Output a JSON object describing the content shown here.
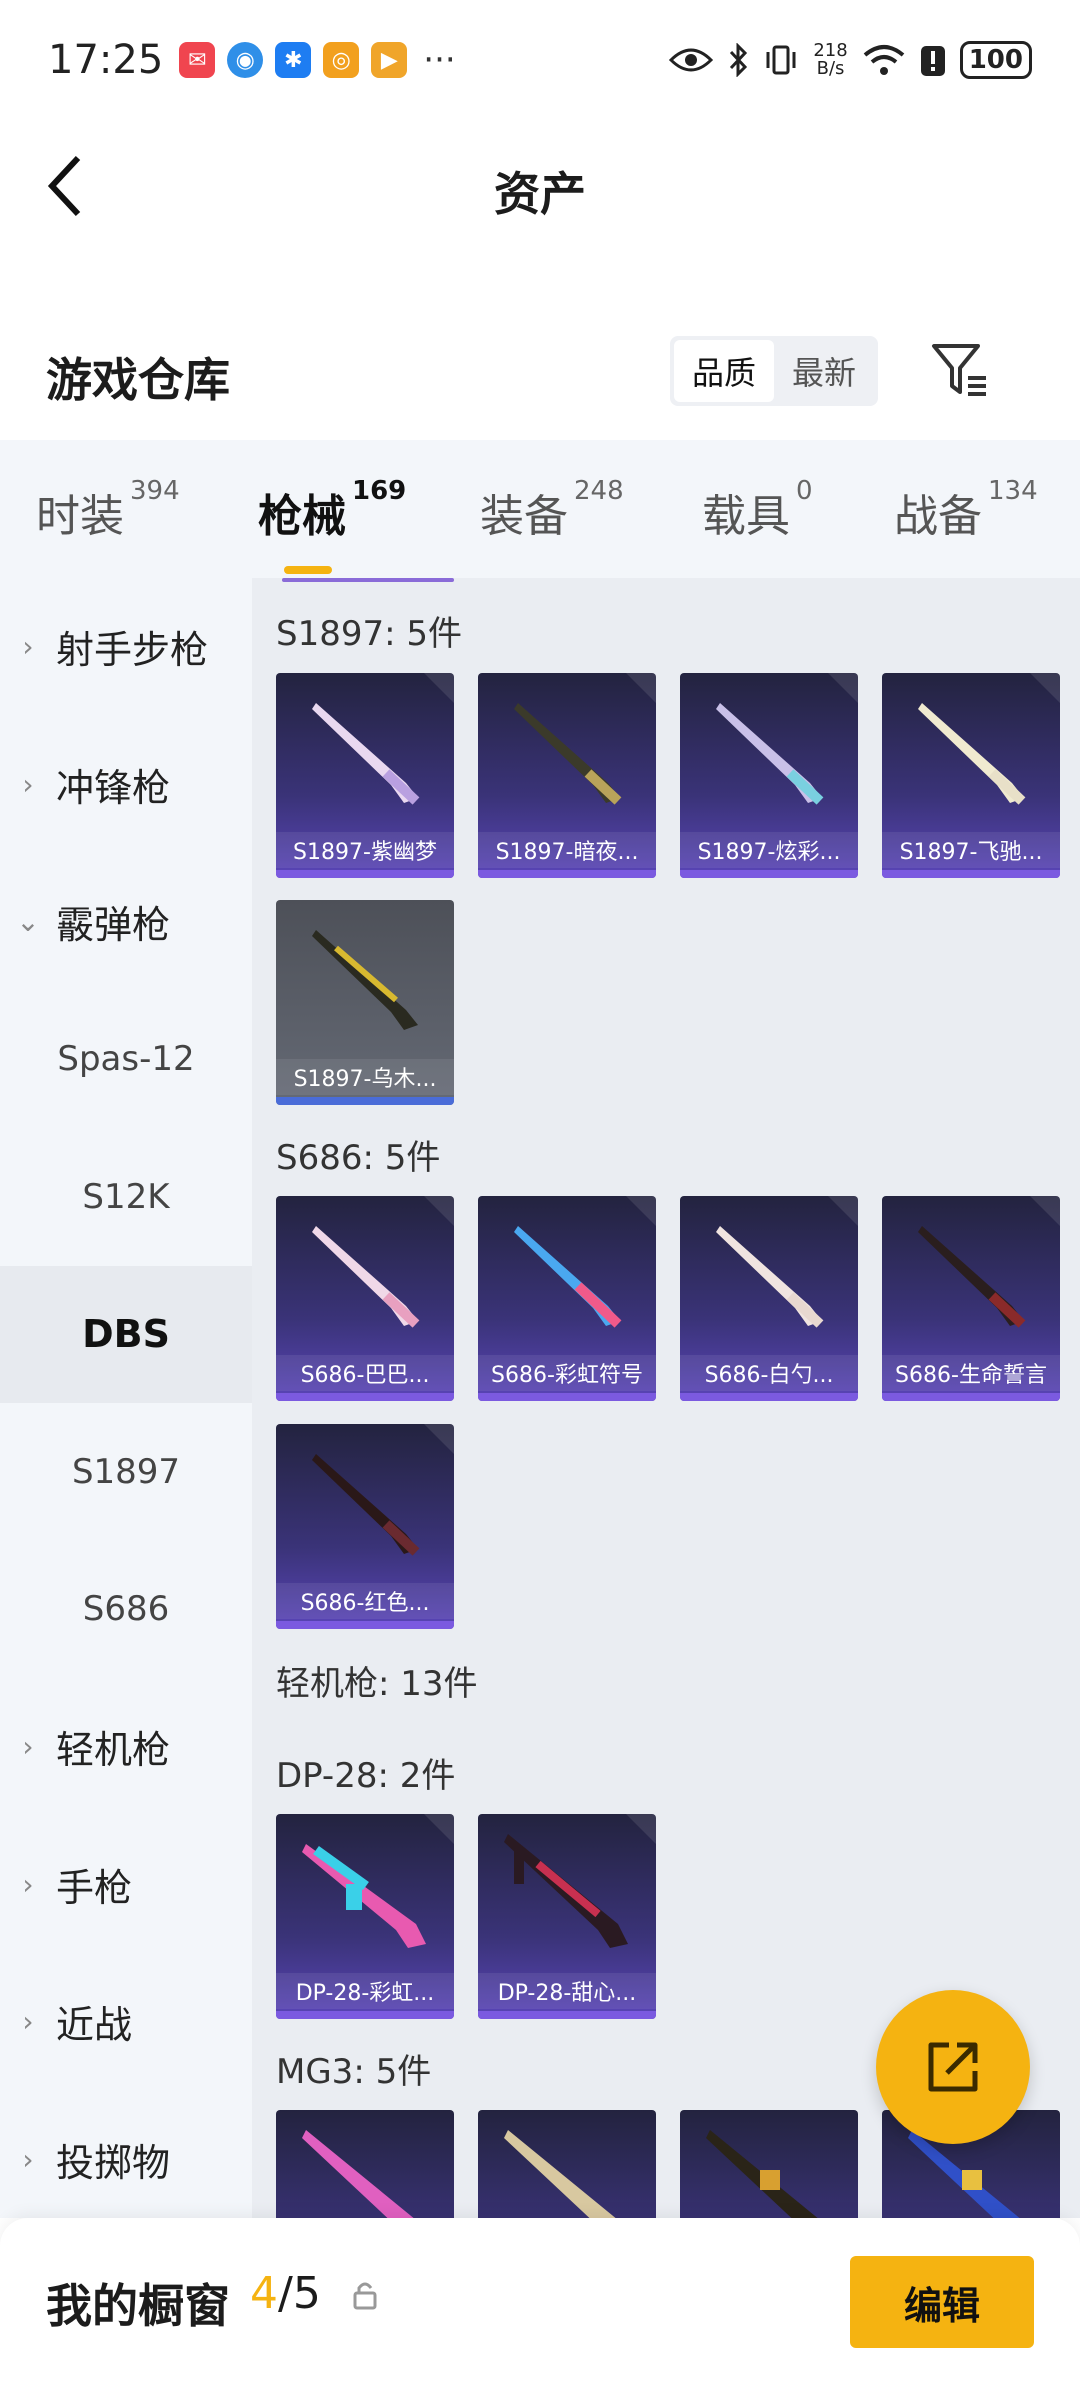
{
  "status_bar": {
    "time": "17:25",
    "apps": [
      {
        "name": "mail-app-icon",
        "color": "#f0454f"
      },
      {
        "name": "browser-app-icon",
        "color": "#2f8fe8"
      },
      {
        "name": "bluetooth-app-icon",
        "color": "#1e7df2"
      },
      {
        "name": "camera-app-icon",
        "color": "#f2a01e"
      },
      {
        "name": "video-app-icon",
        "color": "#f0a52a"
      }
    ],
    "more": "···",
    "speed_value": "218",
    "speed_unit": "B/s",
    "battery": "100"
  },
  "header": {
    "title": "资产"
  },
  "warehouse": {
    "title": "游戏仓库",
    "sort_options": [
      "品质",
      "最新"
    ],
    "sort_selected": "品质"
  },
  "tabs": [
    {
      "label": "时装",
      "count": "394"
    },
    {
      "label": "枪械",
      "count": "169",
      "active": true
    },
    {
      "label": "装备",
      "count": "248"
    },
    {
      "label": "载具",
      "count": "0"
    },
    {
      "label": "战备",
      "count": "134"
    }
  ],
  "sidebar": {
    "items": [
      {
        "label": "射手步枪",
        "type": "category",
        "expanded": false
      },
      {
        "label": "冲锋枪",
        "type": "category",
        "expanded": false
      },
      {
        "label": "霰弹枪",
        "type": "category",
        "expanded": true
      },
      {
        "label": "Spas-12",
        "type": "sub"
      },
      {
        "label": "S12K",
        "type": "sub"
      },
      {
        "label": "DBS",
        "type": "sub",
        "selected": true
      },
      {
        "label": "S1897",
        "type": "sub"
      },
      {
        "label": "S686",
        "type": "sub"
      },
      {
        "label": "轻机枪",
        "type": "category",
        "expanded": false
      },
      {
        "label": "手枪",
        "type": "category",
        "expanded": false
      },
      {
        "label": "近战",
        "type": "category",
        "expanded": false
      },
      {
        "label": "投掷物",
        "type": "category",
        "expanded": false
      }
    ]
  },
  "groups": {
    "s1897": {
      "title": "S1897: 5件",
      "items": [
        "S1897-紫幽梦",
        "S1897-暗夜...",
        "S1897-炫彩...",
        "S1897-飞驰...",
        "S1897-乌木..."
      ]
    },
    "s686": {
      "title": "S686: 5件",
      "items": [
        "S686-巴巴...",
        "S686-彩虹符号",
        "S686-白勺...",
        "S686-生命誓言",
        "S686-红色..."
      ]
    },
    "lmg": {
      "title": "轻机枪: 13件"
    },
    "dp28": {
      "title": "DP-28: 2件",
      "items": [
        "DP-28-彩虹...",
        "DP-28-甜心..."
      ]
    },
    "mg3": {
      "title": "MG3: 5件"
    }
  },
  "bottom_bar": {
    "title": "我的橱窗",
    "count_current": "4",
    "count_sep": "/",
    "count_total": "5",
    "edit_label": "编辑"
  },
  "colors": {
    "accent": "#f5b311",
    "card_purple": "#3a3378",
    "rarity_purple": "#7b5ae0"
  }
}
